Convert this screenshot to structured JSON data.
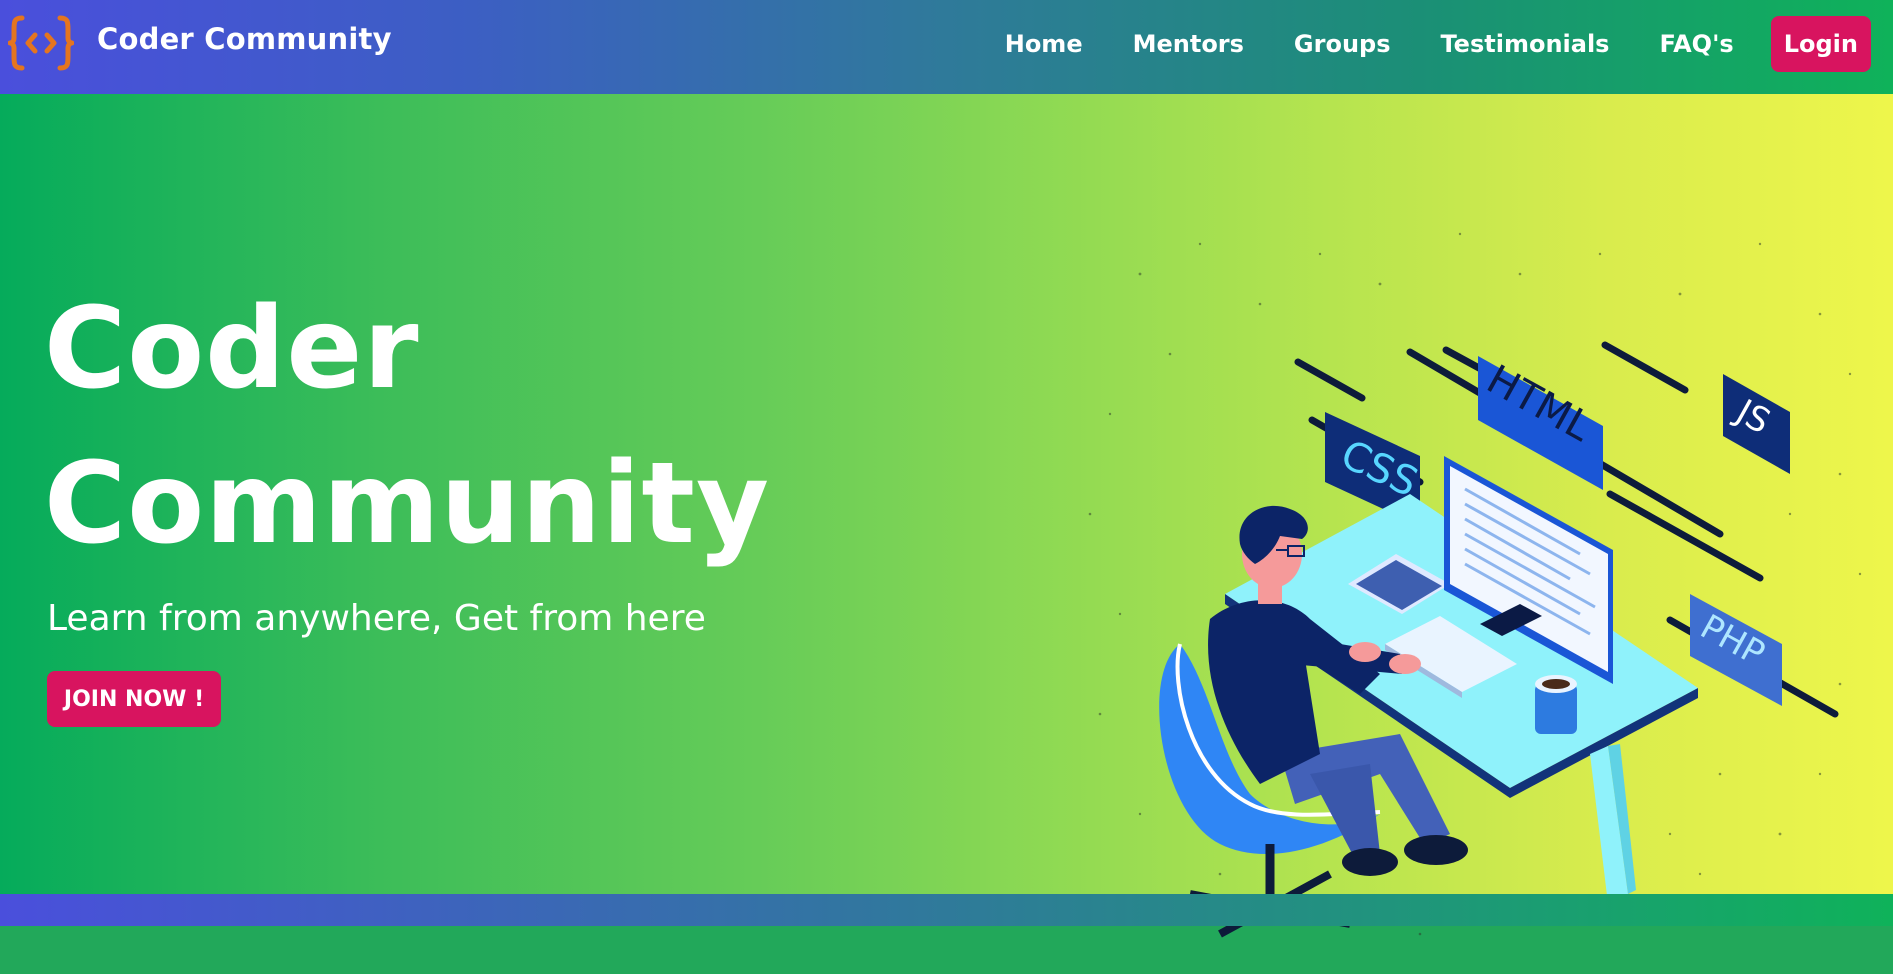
{
  "navbar": {
    "brand": "Coder Community",
    "logo_icon": "code-braces-icon",
    "links": [
      "Home",
      "Mentors",
      "Groups",
      "Testimonials",
      "FAQ's"
    ],
    "login_label": "Login"
  },
  "hero": {
    "title_line1": "Coder",
    "title_line2": "Community",
    "subtitle": "Learn from anywhere, Get from here",
    "cta_label": "JOIN NOW !",
    "illustration_tags": [
      "HTML",
      "CSS",
      "JS",
      "PHP"
    ]
  },
  "colors": {
    "accent": "#d8145f",
    "nav_gradient_start": "#4a4fdc",
    "nav_gradient_end": "#0fb25a",
    "hero_gradient_start": "#05ab5b",
    "hero_gradient_end": "#eef64b",
    "logo_orange": "#e4751f"
  }
}
